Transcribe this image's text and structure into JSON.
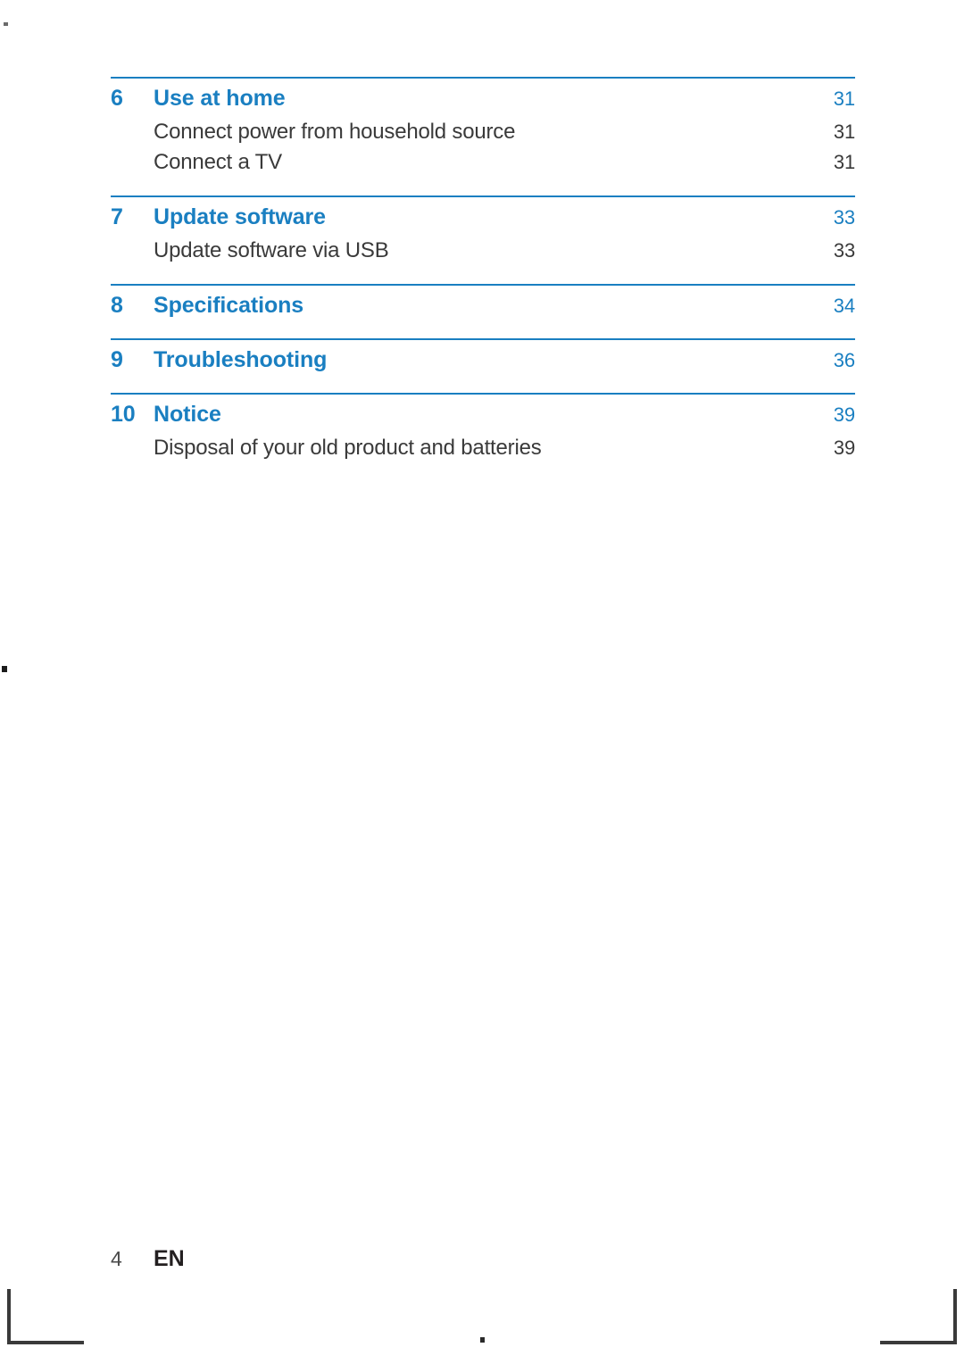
{
  "document": {
    "type": "table-of-contents",
    "accent_color": "#1a7fc1",
    "text_color": "#3a3a3a"
  },
  "toc": {
    "groups": [
      {
        "chapter": {
          "num": "6",
          "title": "Use at home",
          "page": "31"
        },
        "entries": [
          {
            "title": "Connect power from household source",
            "page": "31"
          },
          {
            "title": "Connect a TV",
            "page": "31"
          }
        ]
      },
      {
        "chapter": {
          "num": "7",
          "title": "Update software",
          "page": "33"
        },
        "entries": [
          {
            "title": "Update software via USB",
            "page": "33"
          }
        ]
      },
      {
        "chapter": {
          "num": "8",
          "title": "Specifications",
          "page": "34"
        },
        "entries": []
      },
      {
        "chapter": {
          "num": "9",
          "title": "Troubleshooting",
          "page": "36"
        },
        "entries": []
      },
      {
        "chapter": {
          "num": "10",
          "title": "Notice",
          "page": "39"
        },
        "entries": [
          {
            "title": "Disposal of your old product and batteries",
            "page": "39"
          }
        ]
      }
    ]
  },
  "footer": {
    "page_number": "4",
    "language": "EN"
  }
}
